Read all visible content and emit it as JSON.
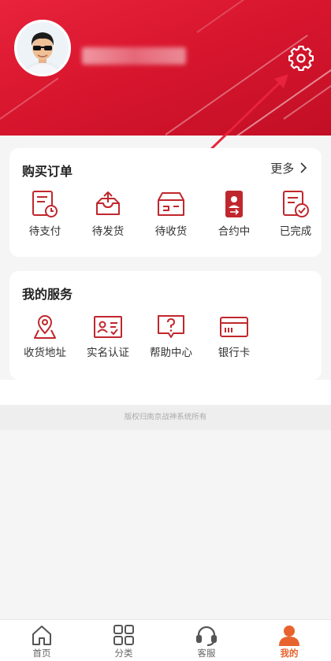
{
  "header": {
    "avatar_icon": "avatar-icon",
    "username_obscured": true,
    "settings_icon": "gear-icon"
  },
  "orders": {
    "title": "购买订单",
    "more_label": "更多",
    "items": [
      {
        "label": "待支付",
        "icon": "pending-payment-icon"
      },
      {
        "label": "待发货",
        "icon": "pending-shipment-icon"
      },
      {
        "label": "待收货",
        "icon": "pending-receipt-icon"
      },
      {
        "label": "合约中",
        "icon": "contract-icon"
      },
      {
        "label": "已完成",
        "icon": "completed-icon"
      }
    ]
  },
  "services": {
    "title": "我的服务",
    "items": [
      {
        "label": "收货地址",
        "icon": "location-icon"
      },
      {
        "label": "实名认证",
        "icon": "id-card-icon"
      },
      {
        "label": "帮助中心",
        "icon": "help-icon"
      },
      {
        "label": "银行卡",
        "icon": "bank-card-icon"
      }
    ]
  },
  "footer": {
    "copyright": "版权归南京战神系统所有"
  },
  "tabbar": {
    "tabs": [
      {
        "label": "首页",
        "icon": "home-icon",
        "active": false
      },
      {
        "label": "分类",
        "icon": "category-icon",
        "active": false
      },
      {
        "label": "客服",
        "icon": "headset-icon",
        "active": false
      },
      {
        "label": "我的",
        "icon": "profile-icon",
        "active": true
      }
    ]
  },
  "colors": {
    "brand_red": "#e8233b",
    "icon_red": "#c0272d",
    "active_tab": "#e8622d"
  }
}
